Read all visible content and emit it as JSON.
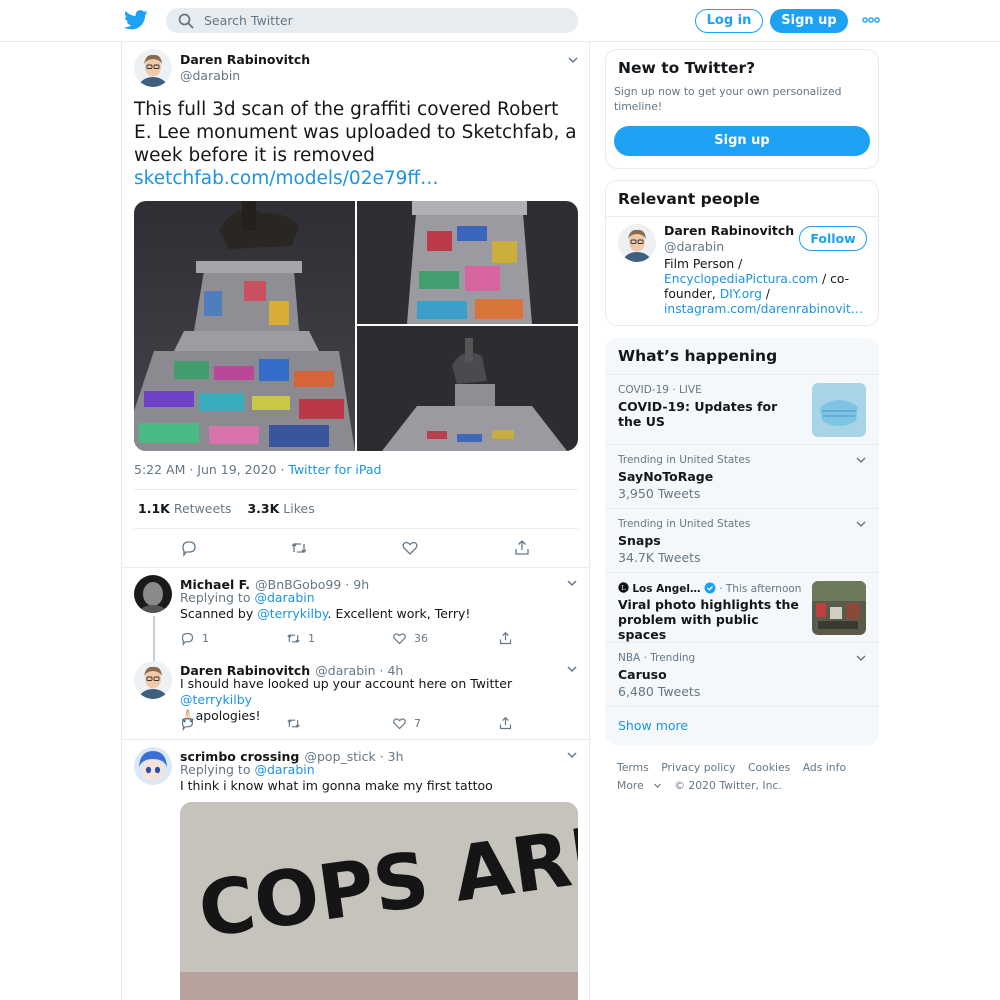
{
  "header": {
    "search_placeholder": "Search Twitter",
    "login_label": "Log in",
    "signup_label": "Sign up",
    "more_icon": "ellipsis-icon"
  },
  "tweet": {
    "name": "Daren Rabinovitch",
    "handle": "@darabin",
    "text": "This full 3d scan of the graffiti covered Robert E. Lee monument was uploaded to Sketchfab, a week before it is removed",
    "link": "sketchfab.com/models/02e79ff…",
    "time": "5:22 AM · Jun 19, 2020 · ",
    "source": "Twitter for iPad",
    "retweets_count": "1.1K",
    "retweets_label": "Retweets",
    "likes_count": "3.3K",
    "likes_label": "Likes"
  },
  "replies": [
    {
      "name": "Michael F.",
      "handle": "@BnBGobo99",
      "age": " · 9h",
      "replying_to_label": "Replying to ",
      "replying_to": "@darabin",
      "text_before": "Scanned by ",
      "mention": "@terrykilby",
      "text_after": ".  Excellent work, Terry!",
      "reply_count": "1",
      "retweet_count": "1",
      "like_count": "36"
    },
    {
      "name": "Daren Rabinovitch",
      "handle": "@darabin",
      "age": " · 4h",
      "text_before": "I should have looked up your account here on Twitter ",
      "mention": "@terrykilby",
      "text_line2": "🙏🏻apologies!",
      "like_count": "7"
    },
    {
      "name": "scrimbo crossing",
      "handle": "@pop_stick",
      "age": " · 3h",
      "replying_to_label": "Replying to ",
      "replying_to": "@darabin",
      "text": "I think i know what im gonna make my first tattoo",
      "graffiti": "COPS ARE SIMPS"
    }
  ],
  "new_to_twitter": {
    "title": "New to Twitter?",
    "text": "Sign up now to get your own personalized timeline!",
    "button": "Sign up"
  },
  "relevant_people": {
    "title": "Relevant people",
    "name": "Daren Rabinovitch",
    "handle": "@darabin",
    "follow": "Follow",
    "bio_1": "Film Person / ",
    "bio_link1": "EncyclopediaPictura.com",
    "bio_2": " / co-founder, ",
    "bio_link2": "DIY.org",
    "bio_3": " / ",
    "bio_link3": "instagram.com/darenrabinovit…"
  },
  "whats_happening": {
    "title": "What’s happening",
    "items": [
      {
        "meta_a": "COVID-19",
        "meta_b": " · LIVE",
        "title": "COVID-19: Updates for the US"
      },
      {
        "meta": "Trending in United States",
        "title": "SayNoToRage",
        "count": "3,950 Tweets"
      },
      {
        "meta": "Trending in United States",
        "title": "Snaps",
        "count": "34.7K Tweets"
      },
      {
        "meta_a": "Los Angel…",
        "meta_b": " · This afternoon",
        "title": "Viral photo highlights the problem with public spaces"
      },
      {
        "meta": "NBA · Trending",
        "title": "Caruso",
        "count": "6,480 Tweets"
      }
    ],
    "show_more": "Show more"
  },
  "footer": {
    "terms": "Terms",
    "privacy": "Privacy policy",
    "cookies": "Cookies",
    "ads": "Ads info",
    "more": "More",
    "copyright": "© 2020 Twitter, Inc."
  },
  "colors": {
    "accent": "#1da1f2",
    "link": "#1b95e0",
    "muted": "#657786",
    "border": "#e6ecf0"
  }
}
